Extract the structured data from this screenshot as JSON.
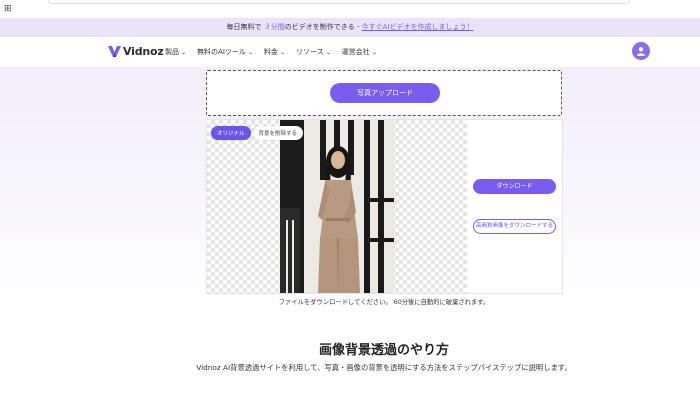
{
  "browser": {
    "grid_icon": "grid-icon"
  },
  "promo": {
    "prefix": "毎日無料で",
    "minutes": "３分間",
    "middle": "のビデオを制作できる ",
    "sep": "- ",
    "link": "今すぐAIビデオを作成しましょう！"
  },
  "nav": {
    "logo_text": "Vidnoz",
    "menu": [
      {
        "label": "製品"
      },
      {
        "label": "無料のAIツール"
      },
      {
        "label": "料金"
      },
      {
        "label": "リソース"
      },
      {
        "label": "運営会社"
      }
    ]
  },
  "upload": {
    "button_label": "写真アップロード"
  },
  "editor": {
    "tabs": [
      {
        "label": "オリジナル",
        "active": true
      },
      {
        "label": "背景を削除する",
        "active": false
      }
    ],
    "download_label": "ダウンロード",
    "hq_download_label": "高画質画像をダウンロードする"
  },
  "note": "ファイルをダウンロードしてください。 60分後に自動的に破棄されます。",
  "section": {
    "title": "画像背景透過のやり方",
    "subtitle": "Vidnoz AI背景透過サイトを利用して、写真・画像の背景を透明にする方法をステップバイステップに説明します。"
  },
  "colors": {
    "accent": "#7b5cf0",
    "promo_bg": "#e9e4fb"
  }
}
